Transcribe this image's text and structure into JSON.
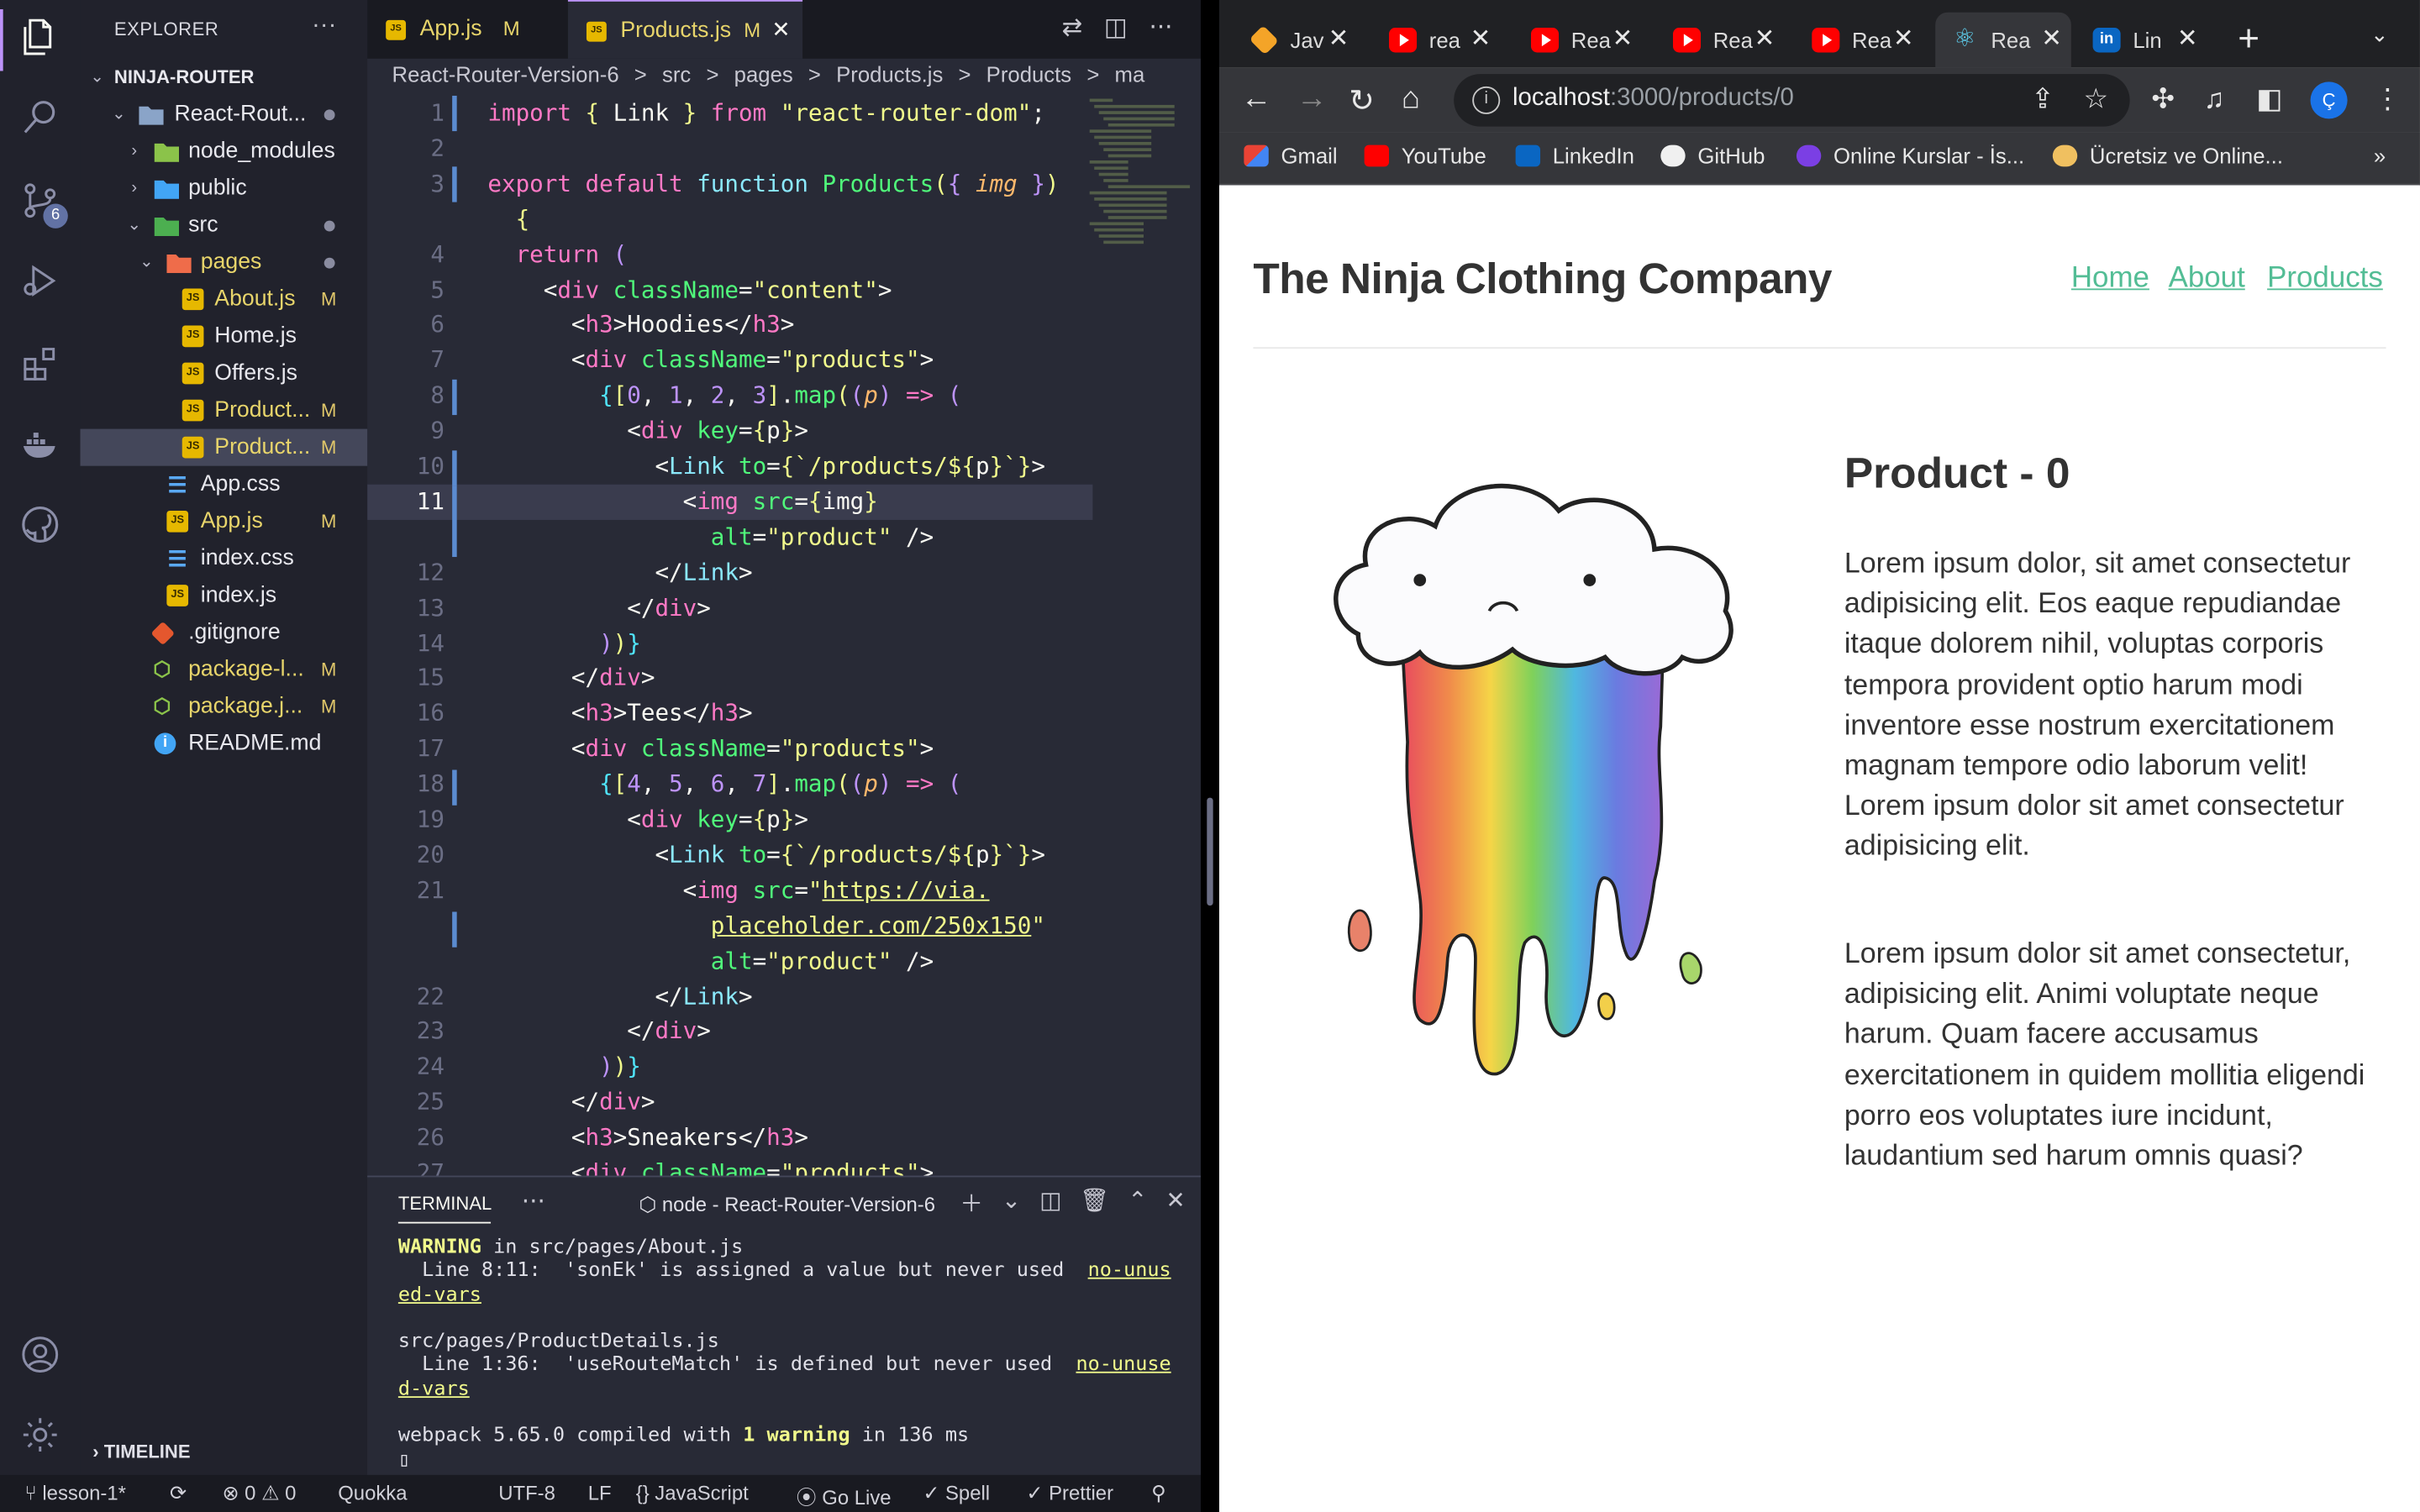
{
  "vscode": {
    "explorer": {
      "title": "EXPLORER",
      "root": "NINJA-ROUTER",
      "tree": [
        {
          "label": "React-Rout...",
          "mark": ""
        },
        {
          "label": "node_modules",
          "mark": ""
        },
        {
          "label": "public",
          "mark": ""
        },
        {
          "label": "src",
          "mark": ""
        },
        {
          "label": "pages",
          "mark": ""
        },
        {
          "label": "About.js",
          "mark": "M"
        },
        {
          "label": "Home.js",
          "mark": ""
        },
        {
          "label": "Offers.js",
          "mark": ""
        },
        {
          "label": "Product...",
          "mark": "M"
        },
        {
          "label": "Product...",
          "mark": "M"
        },
        {
          "label": "App.css",
          "mark": ""
        },
        {
          "label": "App.js",
          "mark": "M"
        },
        {
          "label": "index.css",
          "mark": ""
        },
        {
          "label": "index.js",
          "mark": ""
        },
        {
          "label": ".gitignore",
          "mark": ""
        },
        {
          "label": "package-l...",
          "mark": "M"
        },
        {
          "label": "package.j...",
          "mark": "M"
        },
        {
          "label": "README.md",
          "mark": ""
        }
      ],
      "timeline": "TIMELINE",
      "scm_badge": "6"
    },
    "tabs": [
      {
        "label": "App.js",
        "mark": "M"
      },
      {
        "label": "Products.js",
        "mark": "M"
      }
    ],
    "breadcrumbs": [
      "React-Router-Version-6",
      ">",
      "src",
      ">",
      "pages",
      ">",
      "Products.js",
      ">",
      "Products",
      ">",
      "ma"
    ],
    "line_numbers": [
      "1",
      "2",
      "3",
      "",
      "4",
      "5",
      "6",
      "7",
      "8",
      "9",
      "10",
      "11",
      "",
      "12",
      "13",
      "14",
      "15",
      "16",
      "17",
      "18",
      "19",
      "20",
      "21",
      "",
      "",
      "22",
      "23",
      "24",
      "25",
      "26",
      "27"
    ],
    "terminal": {
      "tab": "TERMINAL",
      "name": "node - React-Router-Version-6",
      "l1_warn": "WARNING",
      "l1_rest": " in src/pages/About.js",
      "l2": "  Line 8:11:  'sonEk' is assigned a value but never used  ",
      "l2_rule": "no-unus",
      "l3_rule": "ed-vars",
      "l4": "src/pages/ProductDetails.js",
      "l5": "  Line 1:36:  'useRouteMatch' is defined but never used  ",
      "l5_rule": "no-unuse",
      "l6_rule": "d-vars",
      "l7a": "webpack 5.65.0 compiled with ",
      "l7b": "1 warning",
      "l7c": " in 136 ms"
    },
    "status": {
      "branch": "lesson-1*",
      "errors": "0",
      "warnings": "0",
      "quokka": "Quokka",
      "encoding": "UTF-8",
      "eol": "LF",
      "language": "JavaScript",
      "golive": "Go Live",
      "spell": "Spell",
      "prettier": "Prettier"
    }
  },
  "chrome": {
    "tabs": [
      {
        "title": "Jav"
      },
      {
        "title": "rea"
      },
      {
        "title": "Rea"
      },
      {
        "title": "Rea"
      },
      {
        "title": "Rea"
      },
      {
        "title": "Rea"
      },
      {
        "title": "Lin"
      }
    ],
    "url_host": "localhost",
    "url_path": ":3000/products/0",
    "profile_initial": "Ç",
    "bookmarks": [
      "Gmail",
      "YouTube",
      "LinkedIn",
      "GitHub",
      "Online Kurslar - İs...",
      "Ücretsiz ve Online..."
    ],
    "page": {
      "site_title": "The Ninja Clothing Company",
      "nav": [
        "Home",
        "About",
        "Products"
      ],
      "product_title": "Product - 0",
      "para1": "Lorem ipsum dolor, sit amet consectetur adipisicing elit. Eos eaque repudiandae itaque dolorem nihil, voluptas corporis tempora provident optio harum modi inventore esse nostrum exercitationem magnam tempore odio laborum velit! Lorem ipsum dolor sit amet consectetur adipisicing elit.",
      "para2": "Lorem ipsum dolor sit amet consectetur, adipisicing elit. Animi voluptate neque harum. Quam facere accusamus exercitationem in quidem mollitia eligendi porro eos voluptates iure incidunt, laudantium sed harum omnis quasi?"
    }
  },
  "colors": {
    "accent": "#bd93f9",
    "link": "#53bd95",
    "editor_bg": "#282a36"
  }
}
